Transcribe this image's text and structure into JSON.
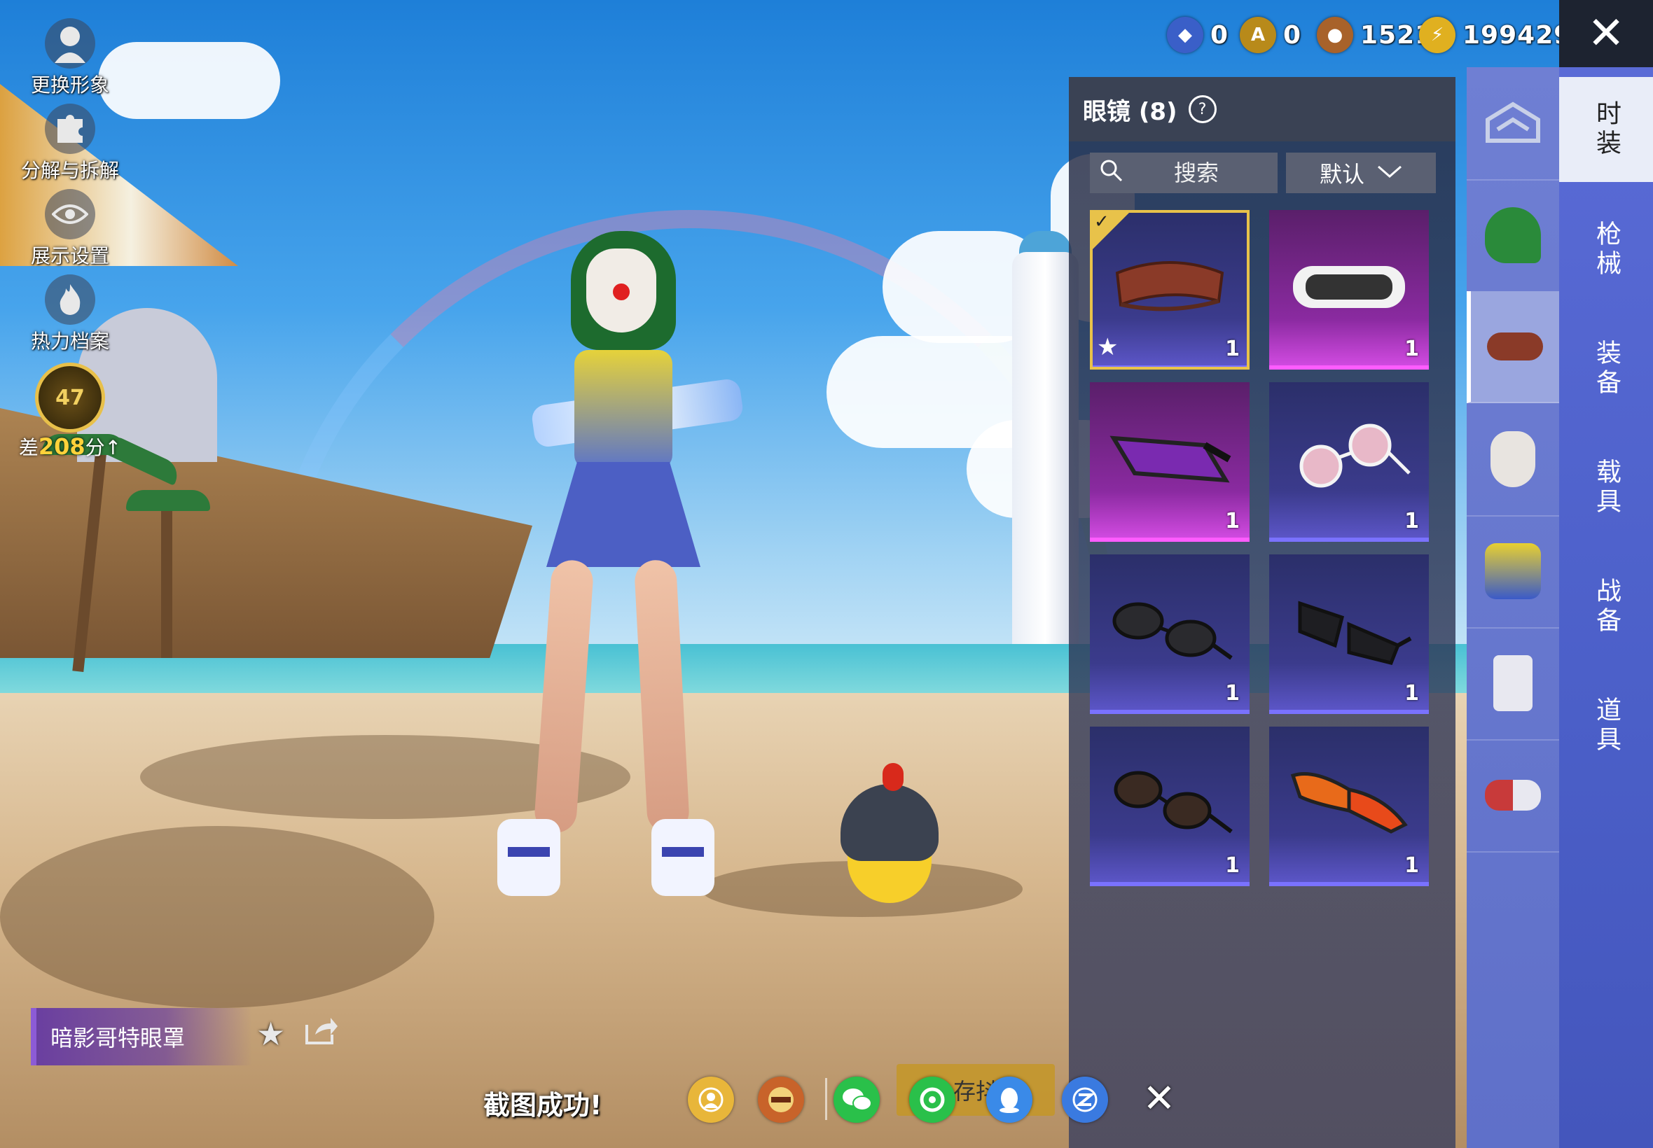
{
  "left_menu": [
    {
      "label": "更换形象",
      "icon": "avatar-icon"
    },
    {
      "label": "分解与拆解",
      "icon": "puzzle-icon"
    },
    {
      "label": "展示设置",
      "icon": "eye-icon"
    },
    {
      "label": "热力档案",
      "icon": "flame-icon"
    }
  ],
  "rank": {
    "level": "47",
    "gap_prefix": "差",
    "gap_points": "208",
    "gap_suffix": "分"
  },
  "currencies": [
    {
      "icon": "blue-token-icon",
      "value": "0",
      "color": "#3a5fc8"
    },
    {
      "icon": "gold-a-token-icon",
      "value": "0",
      "color": "#b88a1a"
    },
    {
      "icon": "bronze-coin-icon",
      "value": "1521",
      "color": "#a8622a"
    },
    {
      "icon": "lightning-coin-icon",
      "value": "199429",
      "color": "#e0b020"
    }
  ],
  "panel": {
    "title": "眼镜 (8)",
    "search_placeholder": "搜索",
    "sort_label": "默认"
  },
  "items": [
    {
      "name": "brown-blindfold",
      "qty": "1",
      "rarity": "blue",
      "selected": true,
      "favorite": true,
      "color": "#8a3a28"
    },
    {
      "name": "white-goggles",
      "qty": "1",
      "rarity": "purple",
      "selected": false,
      "favorite": false,
      "color": "#f2f2f2"
    },
    {
      "name": "purple-goggles",
      "qty": "1",
      "rarity": "purple",
      "selected": false,
      "favorite": false,
      "color": "#7a2ab0"
    },
    {
      "name": "pink-round-glasses",
      "qty": "1",
      "rarity": "blue",
      "selected": false,
      "favorite": false,
      "color": "#e8b8c8"
    },
    {
      "name": "dark-sunglasses-1",
      "qty": "1",
      "rarity": "blue",
      "selected": false,
      "favorite": false,
      "color": "#2a2a2e"
    },
    {
      "name": "dark-sunglasses-2",
      "qty": "1",
      "rarity": "blue",
      "selected": false,
      "favorite": false,
      "color": "#1e1e22"
    },
    {
      "name": "brown-sunglasses",
      "qty": "1",
      "rarity": "blue",
      "selected": false,
      "favorite": false,
      "color": "#3a2a22"
    },
    {
      "name": "orange-sport-glasses",
      "qty": "1",
      "rarity": "blue",
      "selected": false,
      "favorite": false,
      "color": "#e86a1a"
    }
  ],
  "main_tabs": [
    "时装",
    "枪械",
    "装备",
    "载具",
    "战备",
    "道具"
  ],
  "sub_categories": [
    {
      "icon": "wardrobe-icon",
      "color": "#c8d0e8"
    },
    {
      "icon": "green-hair-icon",
      "color": "#2a8a3a"
    },
    {
      "icon": "glasses-icon",
      "color": "#8a3a28"
    },
    {
      "icon": "clown-mask-icon",
      "color": "#e8e4e0"
    },
    {
      "icon": "top-outfit-icon",
      "color": "#e8d030"
    },
    {
      "icon": "pants-icon",
      "color": "#e8e8f0"
    },
    {
      "icon": "shoes-icon",
      "color": "#c83a3a"
    }
  ],
  "selected_item_name": "暗影哥特眼罩",
  "share_bar": {
    "toast": "截图成功!",
    "save_label": "存抖",
    "buttons": [
      {
        "icon": "profile-share-icon",
        "color": "#e8b63a"
      },
      {
        "icon": "peace-elite-icon",
        "color": "#c8632a"
      },
      {
        "icon": "wechat-icon",
        "color": "#2ac04a"
      },
      {
        "icon": "moments-icon",
        "color": "#2ac04a"
      },
      {
        "icon": "qq-icon",
        "color": "#3a8ae8"
      },
      {
        "icon": "qzone-icon",
        "color": "#3a7ae0"
      }
    ]
  }
}
